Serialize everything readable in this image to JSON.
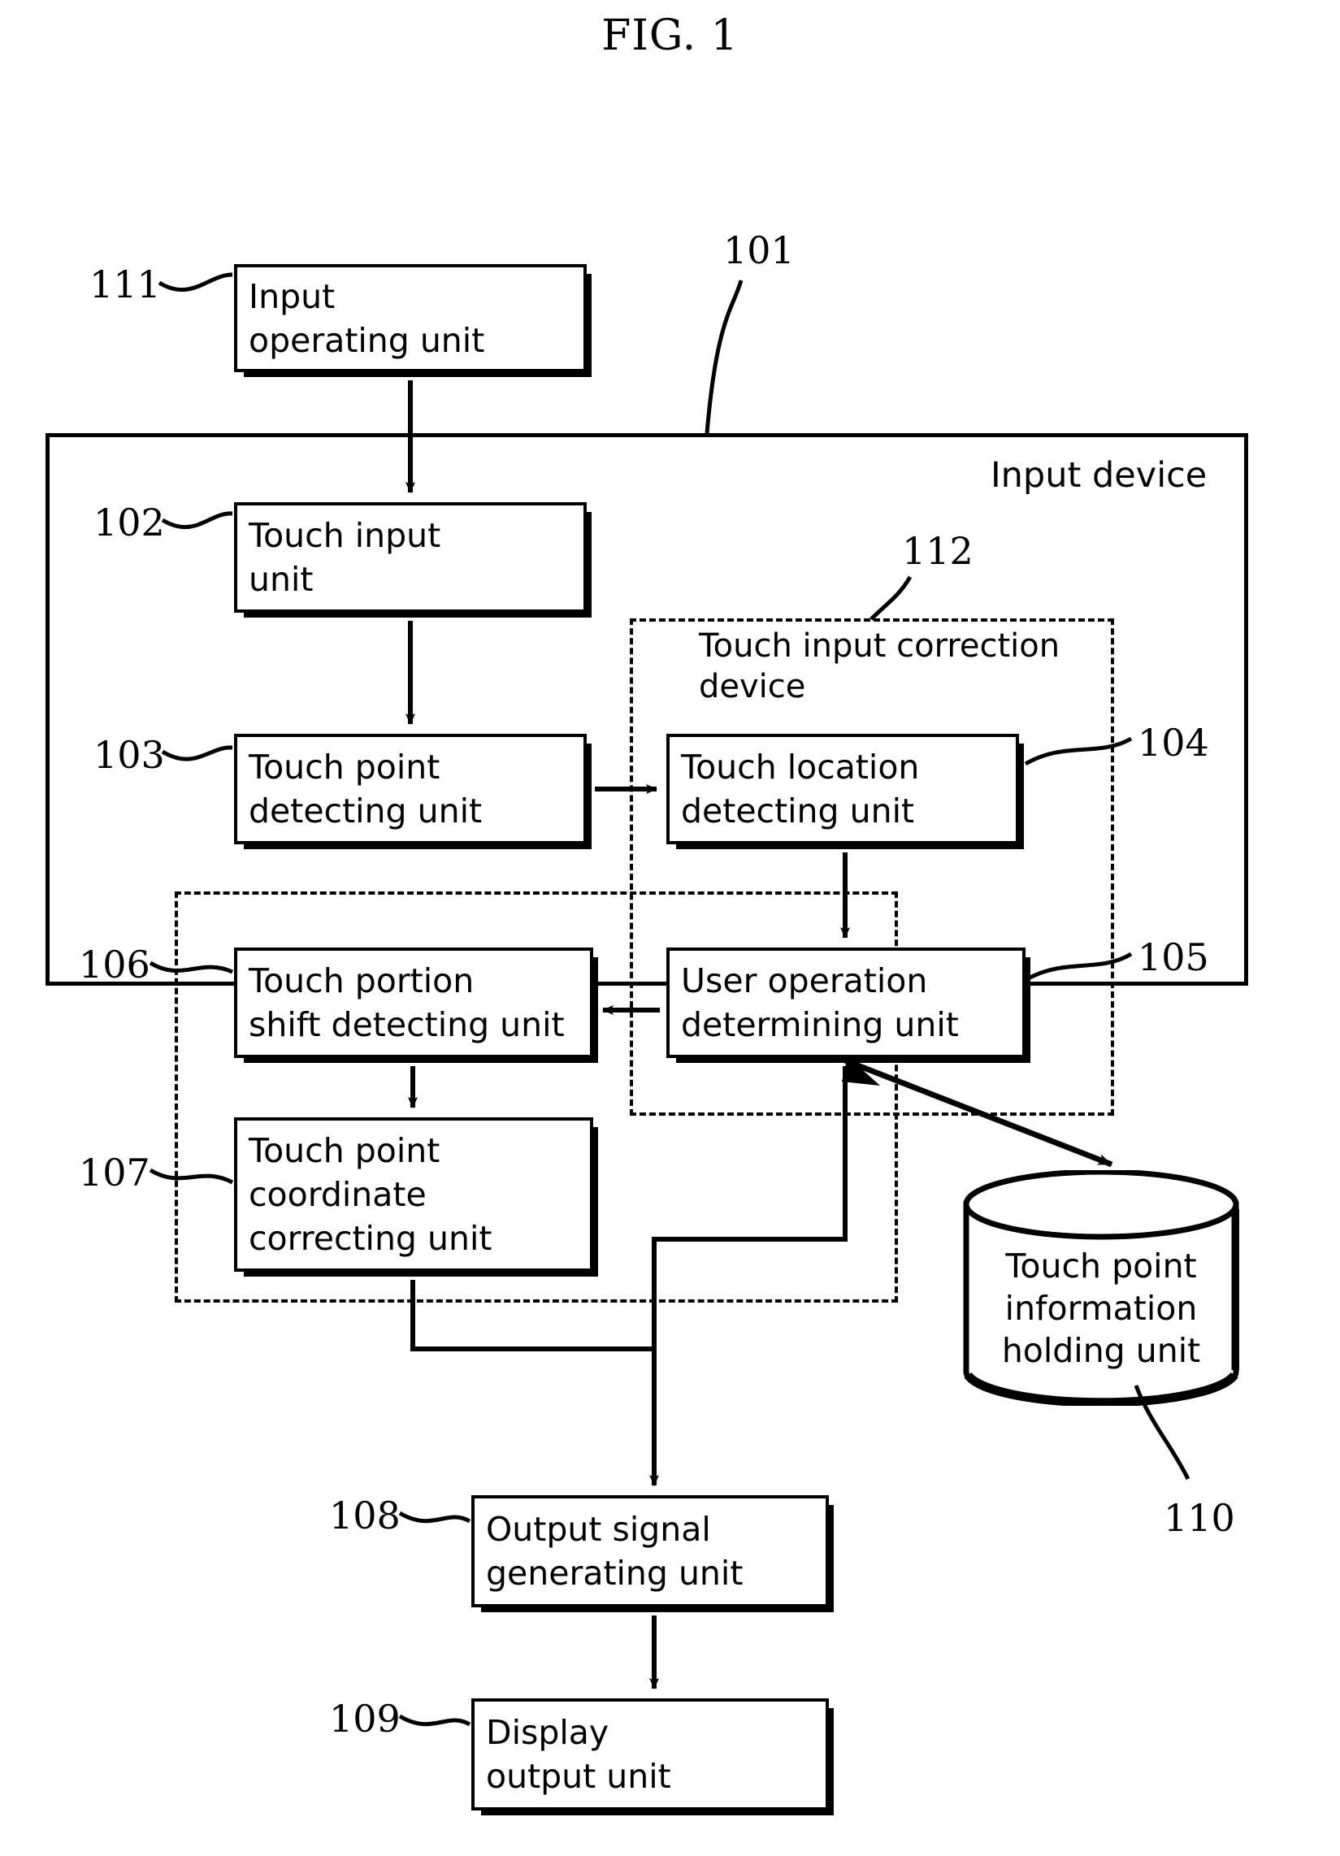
{
  "figure": {
    "title": "FIG. 1"
  },
  "outer_container": {
    "ref": "101",
    "label": "Input device"
  },
  "dashed_containers": [
    {
      "ref": "112",
      "label": "Touch input correction\ndevice"
    },
    {
      "ref": "",
      "label": ""
    }
  ],
  "blocks": [
    {
      "ref": "111",
      "label": "Input\noperating unit"
    },
    {
      "ref": "102",
      "label": "Touch input\nunit"
    },
    {
      "ref": "103",
      "label": "Touch point\ndetecting unit"
    },
    {
      "ref": "104",
      "label": "Touch location\ndetecting unit"
    },
    {
      "ref": "106",
      "label": "Touch portion\nshift detecting unit"
    },
    {
      "ref": "105",
      "label": "User operation\ndetermining unit"
    },
    {
      "ref": "107",
      "label": "Touch point\ncoordinate\ncorrecting unit"
    },
    {
      "ref": "108",
      "label": "Output signal\ngenerating unit"
    },
    {
      "ref": "109",
      "label": "Display\noutput unit"
    }
  ],
  "datastore": {
    "ref": "110",
    "label": "Touch point\ninformation\nholding unit"
  },
  "colors": {
    "ink": "#000000",
    "paper": "#ffffff"
  }
}
